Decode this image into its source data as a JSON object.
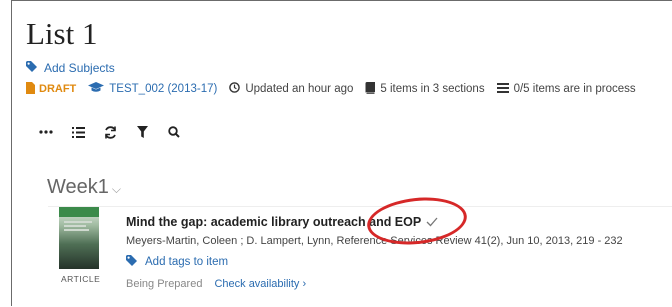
{
  "page": {
    "title": "List 1",
    "add_subjects_label": "Add Subjects"
  },
  "meta": {
    "status": "DRAFT",
    "course": "TEST_002 (2013-17)",
    "updated": "Updated an hour ago",
    "items_count": "5 items in 3 sections",
    "in_process": "0/5 items are in process"
  },
  "toolbar": {
    "icons": [
      "more-icon",
      "list-icon",
      "refresh-icon",
      "filter-icon",
      "search-icon"
    ]
  },
  "section": {
    "name": "Week1"
  },
  "item": {
    "title": "Mind the gap: academic library outreach and EOP",
    "citation": "Meyers-Martin, Coleen ; D. Lampert, Lynn, Reference Services Review 41(2), Jun 10, 2013, 219 - 232",
    "tags_label": "Add tags to item",
    "type_label": "ARTICLE",
    "status": "Being Prepared",
    "availability_label": "Check availability ›"
  },
  "colors": {
    "link": "#2b6cb0",
    "draft": "#e08a10",
    "annotation": "#d62828"
  }
}
